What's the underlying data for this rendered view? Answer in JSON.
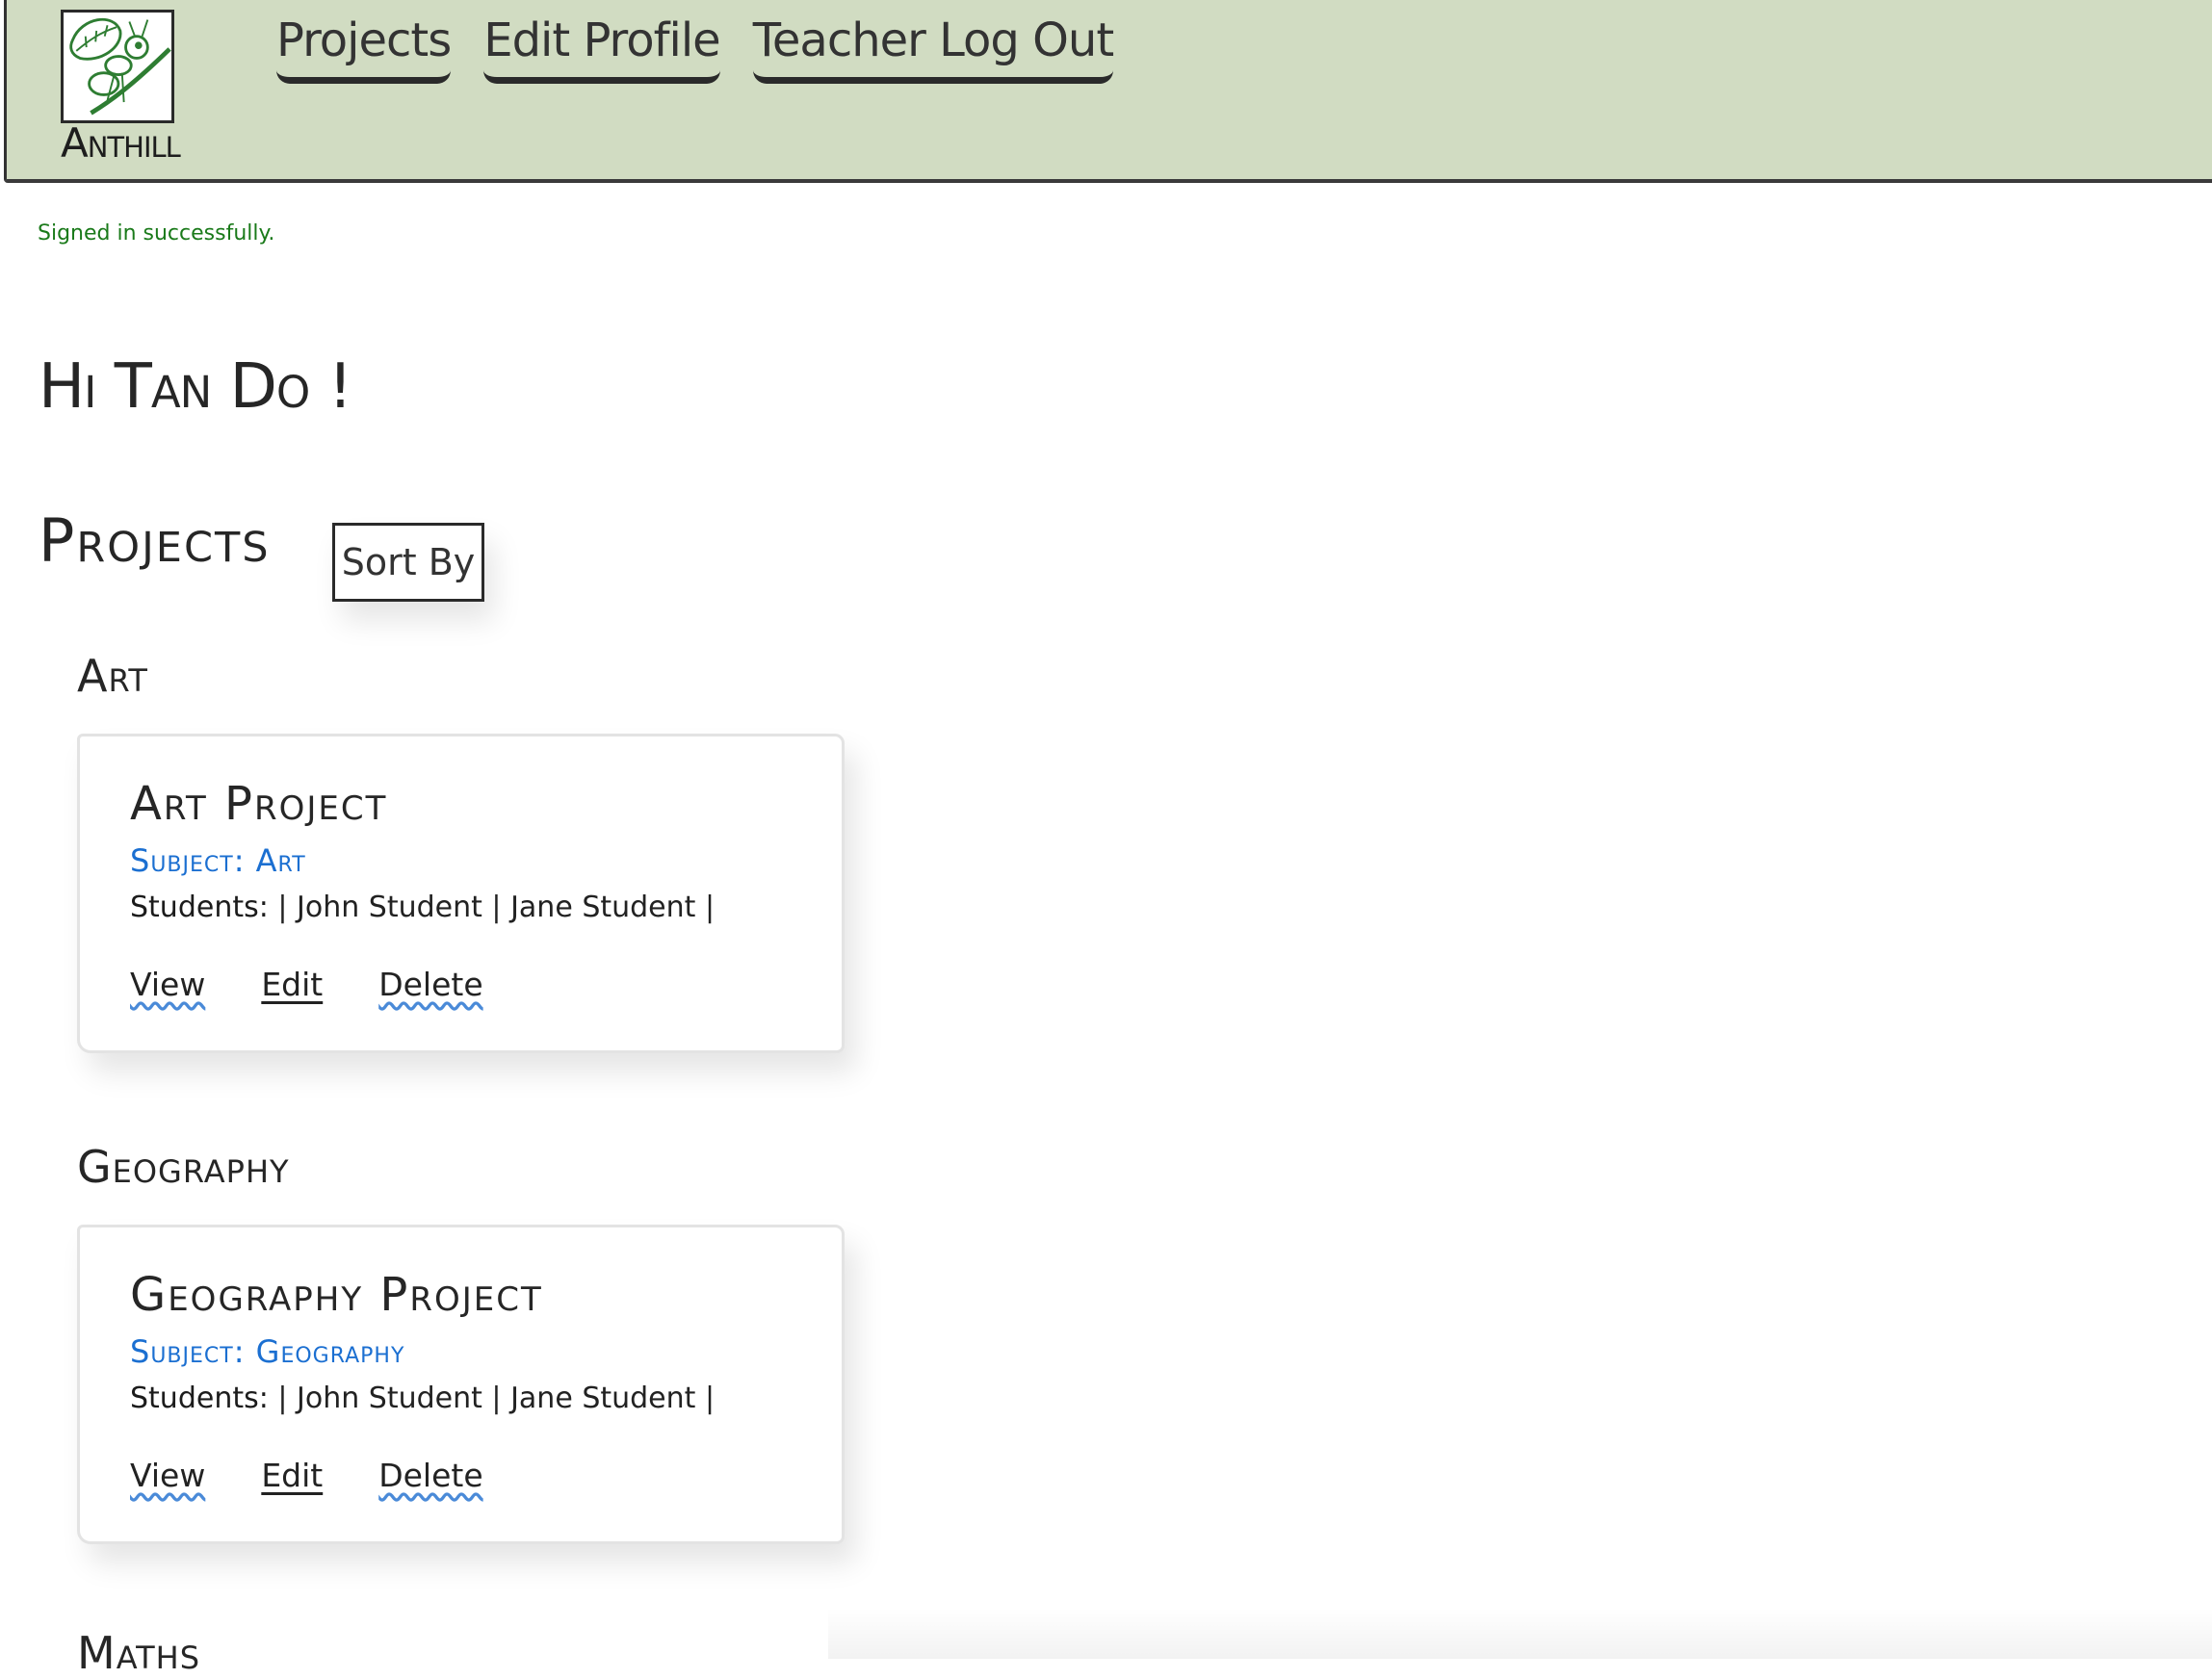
{
  "app": {
    "logo_text": "Anthill"
  },
  "nav": {
    "items": [
      {
        "label": "Projects"
      },
      {
        "label": "Edit Profile"
      },
      {
        "label": "Teacher Log Out"
      }
    ]
  },
  "flash": {
    "message": "Signed in successfully."
  },
  "greeting": "Hi Tan Do !",
  "projects": {
    "title": "Projects",
    "sort_label": "Sort By",
    "groups": [
      {
        "subject": "Art",
        "cards": [
          {
            "title": "Art Project",
            "subject_line": "Subject: Art",
            "students_label": "Students:",
            "students": "| John Student | Jane Student |",
            "actions": {
              "view": "View",
              "edit": "Edit",
              "delete": "Delete"
            }
          }
        ]
      },
      {
        "subject": "Geography",
        "cards": [
          {
            "title": "Geography Project",
            "subject_line": "Subject: Geography",
            "students_label": "Students:",
            "students": "| John Student | Jane Student |",
            "actions": {
              "view": "View",
              "edit": "Edit",
              "delete": "Delete"
            }
          }
        ]
      },
      {
        "subject": "Maths",
        "cards": []
      }
    ]
  },
  "colors": {
    "header_bg": "#d1dcc2",
    "flash_text": "#1a7a1a",
    "subject_link": "#1b6fd1"
  }
}
